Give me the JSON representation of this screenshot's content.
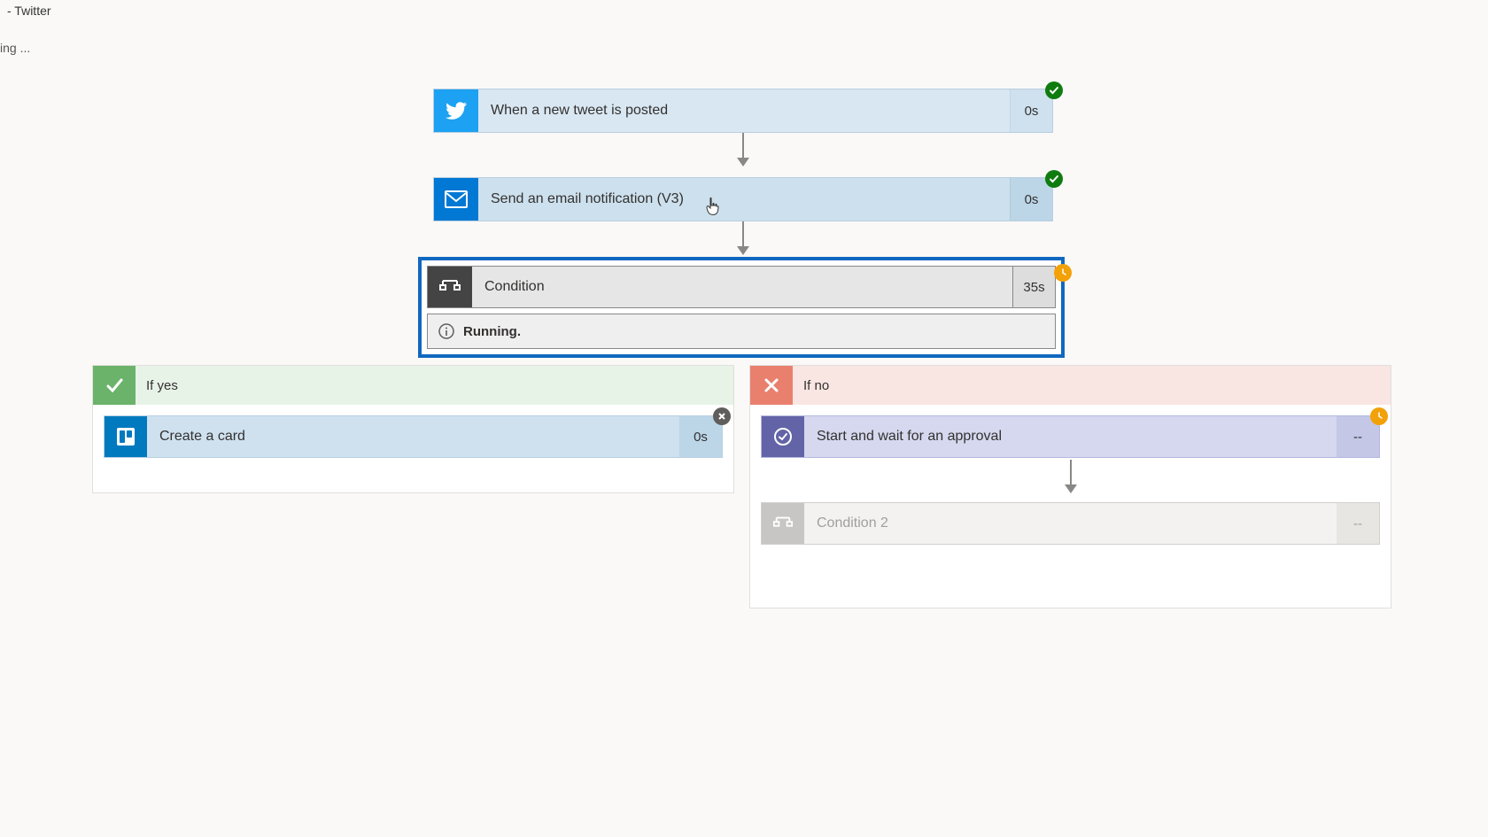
{
  "tab_title": "- Twitter",
  "loading": "ing ...",
  "steps": {
    "trigger": {
      "label": "When a new tweet is posted",
      "duration": "0s",
      "status": "success"
    },
    "email": {
      "label": "Send an email notification (V3)",
      "duration": "0s",
      "status": "success"
    }
  },
  "condition": {
    "label": "Condition",
    "duration": "35s",
    "status": "pending",
    "running_text": "Running."
  },
  "branches": {
    "yes": {
      "title": "If yes",
      "steps": {
        "create_card": {
          "label": "Create a card",
          "duration": "0s",
          "status": "cancel"
        }
      }
    },
    "no": {
      "title": "If no",
      "steps": {
        "approval": {
          "label": "Start and wait for an approval",
          "duration": "--",
          "status": "pending"
        },
        "condition2": {
          "label": "Condition 2",
          "duration": "--",
          "status": "none"
        }
      }
    }
  },
  "colors": {
    "twitter": "#1da1f2",
    "mail": "#0078d4",
    "trello": "#0079bf",
    "approval": "#6264a7"
  }
}
